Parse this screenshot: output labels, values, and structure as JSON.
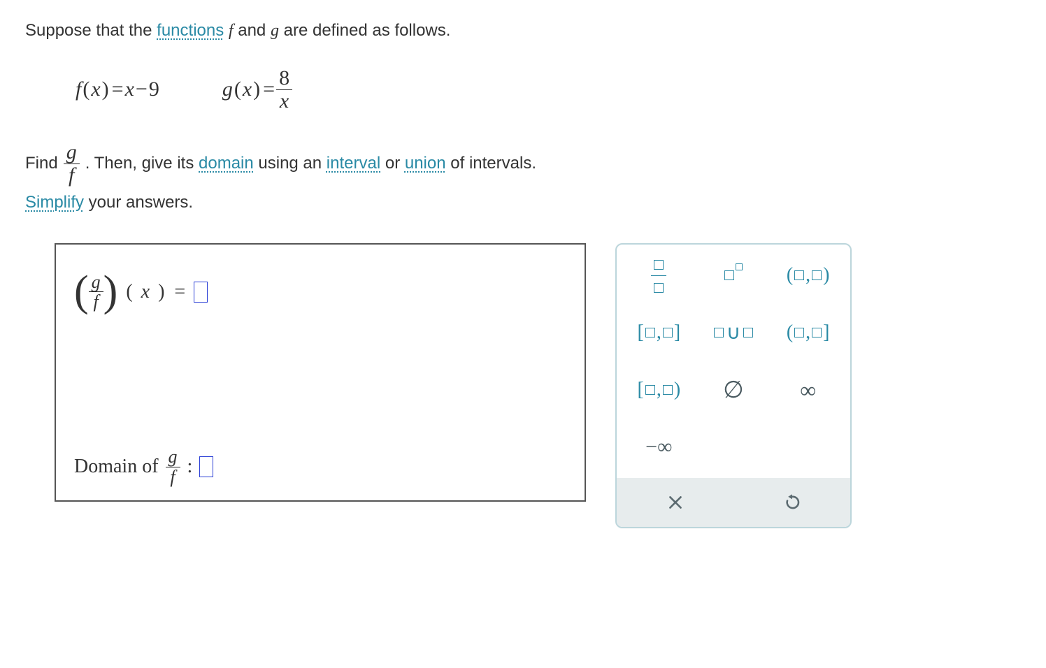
{
  "problem": {
    "intro_part1": "Suppose that the ",
    "link_functions": "functions",
    "intro_part2": " f and g are defined as follows.",
    "f_def_lhs_f": "f",
    "f_def_lhs_open": "(",
    "f_def_lhs_x": "x",
    "f_def_lhs_close": ")",
    "eq": "=",
    "f_def_rhs_x": "x",
    "minus": "−",
    "nine": "9",
    "g_def_lhs_g": "g",
    "g_def_num": "8",
    "g_def_den": "x",
    "find_label": "Find ",
    "gf_g": "g",
    "gf_f": "f",
    "then_text": ". Then, give its ",
    "link_domain": "domain",
    "using_text": " using an ",
    "link_interval": "interval",
    "or_text": " or ",
    "link_union": "union",
    "of_intervals": " of intervals.",
    "link_simplify": "Simplify",
    "simplify_rest": " your answers."
  },
  "answers": {
    "expr_x_open": "(",
    "expr_x": "x",
    "expr_x_close": ")",
    "expr_equals": " = ",
    "domain_prefix": "Domain of  ",
    "colon": " : "
  },
  "palette": {
    "fraction_name": "fraction",
    "exponent_name": "exponent",
    "open_open": "(□,□)",
    "closed_closed": "[□,□]",
    "union": "□∪□",
    "open_closed": "(□,□]",
    "closed_open": "[□,□)",
    "empty_set": "∅",
    "infinity": "∞",
    "neg_infinity": "−∞",
    "clear": "×",
    "undo": "↺"
  }
}
